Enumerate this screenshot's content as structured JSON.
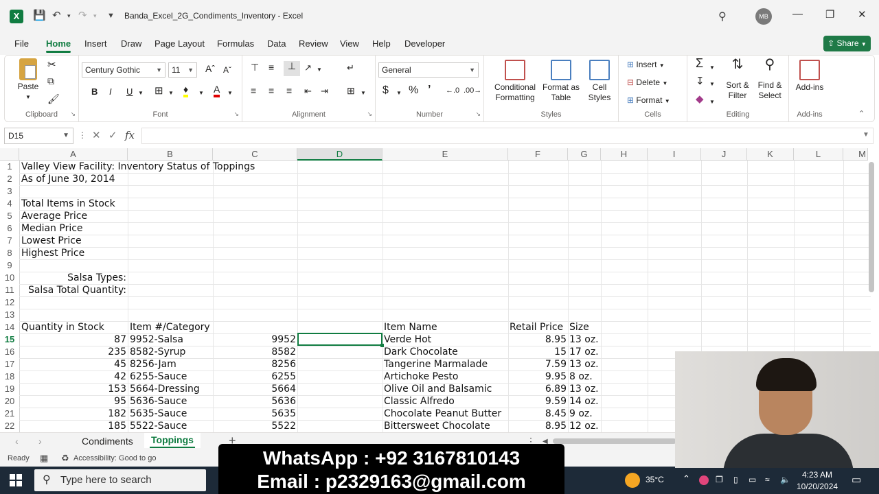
{
  "titlebar": {
    "doc_title": "Banda_Excel_2G_Condiments_Inventory  -  Excel",
    "avatar_initials": "MB",
    "app_letter": "X"
  },
  "menu": {
    "tabs": [
      "File",
      "Home",
      "Insert",
      "Draw",
      "Page Layout",
      "Formulas",
      "Data",
      "Review",
      "View",
      "Help",
      "Developer"
    ],
    "active": "Home",
    "share_label": "Share"
  },
  "ribbon": {
    "clipboard": {
      "paste": "Paste",
      "label": "Clipboard"
    },
    "font": {
      "name": "Century Gothic",
      "size": "11",
      "label": "Font",
      "bold": "B",
      "italic": "I",
      "underline": "U"
    },
    "alignment": {
      "label": "Alignment"
    },
    "number": {
      "format": "General",
      "label": "Number",
      "currency": "$",
      "percent": "%"
    },
    "styles": {
      "conditional": "Conditional Formatting",
      "format_table": "Format as Table",
      "cell_styles": "Cell Styles",
      "label": "Styles"
    },
    "cells": {
      "insert": "Insert",
      "delete": "Delete",
      "format": "Format",
      "label": "Cells"
    },
    "editing": {
      "sort": "Sort & Filter",
      "find": "Find & Select",
      "label": "Editing"
    },
    "addins": {
      "button": "Add-ins",
      "label": "Add-ins"
    }
  },
  "formula_bar": {
    "name_box": "D15",
    "fx": "fx",
    "value": ""
  },
  "columns": [
    "A",
    "B",
    "C",
    "D",
    "E",
    "F",
    "G",
    "H",
    "I",
    "J",
    "K",
    "L",
    "M"
  ],
  "selected_column": "D",
  "selected_row": 15,
  "rows": [
    1,
    2,
    3,
    4,
    5,
    6,
    7,
    8,
    9,
    10,
    11,
    12,
    13,
    14,
    15,
    16,
    17,
    18,
    19,
    20,
    21,
    22
  ],
  "cells": {
    "A1": "Valley View Facility: Inventory Status of Toppings",
    "A2": "As of June 30, 2014",
    "A4": "Total Items in Stock",
    "A5": "Average Price",
    "A6": "Median Price",
    "A7": "Lowest Price",
    "A8": "Highest Price",
    "A10": "Salsa Types:",
    "A11": "Salsa Total Quantity:",
    "A14": "Quantity in Stock",
    "B14": "Item #/Category",
    "E14": "Item Name",
    "F14": "Retail Price",
    "G14": "Size"
  },
  "table_rows": [
    {
      "qty": "87",
      "item": "9952-Salsa",
      "num": "9952",
      "name": "Verde Hot",
      "price": "8.95",
      "size": "13 oz."
    },
    {
      "qty": "235",
      "item": "8582-Syrup",
      "num": "8582",
      "name": "Dark Chocolate",
      "price": "15",
      "size": "17 oz."
    },
    {
      "qty": "45",
      "item": "8256-Jam",
      "num": "8256",
      "name": "Tangerine Marmalade",
      "price": "7.59",
      "size": "13 oz."
    },
    {
      "qty": "42",
      "item": "6255-Sauce",
      "num": "6255",
      "name": "Artichoke Pesto",
      "price": "9.95",
      "size": "8 oz."
    },
    {
      "qty": "153",
      "item": "5664-Dressing",
      "num": "5664",
      "name": "Olive Oil and Balsamic",
      "price": "6.89",
      "size": "13 oz."
    },
    {
      "qty": "95",
      "item": "5636-Sauce",
      "num": "5636",
      "name": "Classic Alfredo",
      "price": "9.59",
      "size": "14 oz."
    },
    {
      "qty": "182",
      "item": "5635-Sauce",
      "num": "5635",
      "name": "Chocolate Peanut Butter",
      "price": "8.45",
      "size": "9 oz."
    },
    {
      "qty": "185",
      "item": "5522-Sauce",
      "num": "5522",
      "name": "Bittersweet Chocolate",
      "price": "8.95",
      "size": "12 oz."
    }
  ],
  "sheets": {
    "tabs": [
      "Condiments",
      "Toppings"
    ],
    "active": "Toppings",
    "add": "+"
  },
  "status": {
    "ready": "Ready",
    "accessibility": "Accessibility: Good to go"
  },
  "taskbar": {
    "search_placeholder": "Type here to search",
    "temp": "35°C",
    "time": "4:23 AM",
    "date": "10/20/2024"
  },
  "banner": {
    "line1": "WhatsApp : +92  3167810143",
    "line2": "Email : p2329163@gmail.com"
  },
  "colors": {
    "accent": "#107c41",
    "share": "#1f7a47",
    "taskbar": "#1d2a38"
  }
}
